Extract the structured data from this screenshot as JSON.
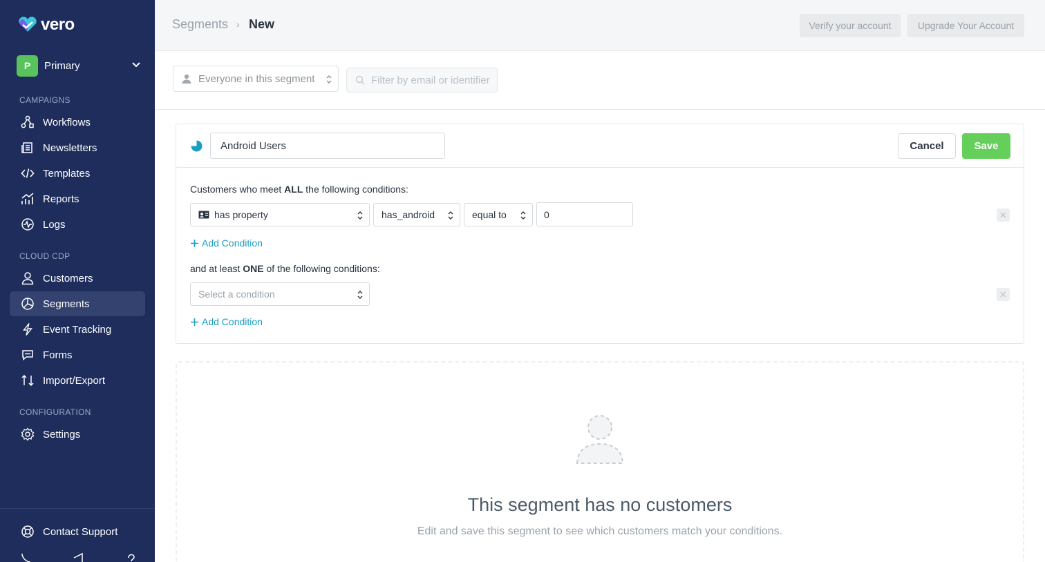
{
  "app": {
    "logo_text": "vero",
    "brand_color": "#1e2d5c",
    "accent_color": "#64cf5a",
    "link_color": "#1a9ec2"
  },
  "account": {
    "initial": "P",
    "name": "Primary"
  },
  "sidebar": {
    "sections": [
      {
        "title": "CAMPAIGNS"
      },
      {
        "title": "CLOUD CDP"
      },
      {
        "title": "CONFIGURATION"
      }
    ],
    "items": [
      {
        "label": "Workflows",
        "icon": "workflow-icon"
      },
      {
        "label": "Newsletters",
        "icon": "newsletter-icon"
      },
      {
        "label": "Templates",
        "icon": "code-icon"
      },
      {
        "label": "Reports",
        "icon": "chart-icon"
      },
      {
        "label": "Logs",
        "icon": "logs-icon"
      },
      {
        "label": "Customers",
        "icon": "user-icon"
      },
      {
        "label": "Segments",
        "icon": "pie-icon",
        "active": true
      },
      {
        "label": "Event Tracking",
        "icon": "bolt-icon"
      },
      {
        "label": "Forms",
        "icon": "chat-icon"
      },
      {
        "label": "Import/Export",
        "icon": "arrows-icon"
      },
      {
        "label": "Settings",
        "icon": "gear-icon"
      }
    ],
    "support_label": "Contact Support"
  },
  "header": {
    "breadcrumb_parent": "Segments",
    "breadcrumb_separator": "›",
    "breadcrumb_current": "New",
    "verify_label": "Verify your account",
    "upgrade_label": "Upgrade Your Account"
  },
  "filter": {
    "audience_select": "Everyone in this segment",
    "search_placeholder": "Filter by email or identifier"
  },
  "editor": {
    "segment_name": "Android Users",
    "cancel_label": "Cancel",
    "save_label": "Save",
    "all_prefix": "Customers who meet ",
    "all_keyword": "ALL",
    "all_suffix": " the following conditions:",
    "condition": {
      "type": "has property",
      "property": "has_android",
      "operator": "equal to",
      "value": "0"
    },
    "add_condition_label": "Add Condition",
    "one_prefix": "and at least ",
    "one_keyword": "ONE",
    "one_suffix": " of the following conditions:",
    "select_placeholder": "Select a condition"
  },
  "empty_state": {
    "title": "This segment has no customers",
    "subtitle": "Edit and save this segment to see which customers match your conditions."
  }
}
